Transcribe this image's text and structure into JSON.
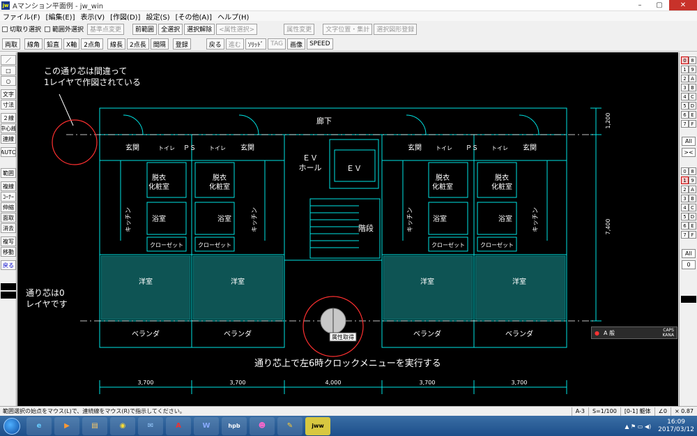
{
  "window": {
    "title": "Aマンション平面例 - jw_win",
    "app_icon": "jw"
  },
  "menu": [
    "ファイル(F)",
    "[編集(E)]",
    "表示(V)",
    "[作図(D)]",
    "設定(S)",
    "[その他(A)]",
    "ヘルプ(H)"
  ],
  "toolbar1": {
    "check1": "切取り選択",
    "check2": "範囲外選択",
    "btn_base": "基準点変更",
    "btn_prev": "前範囲",
    "btn_all": "全選択",
    "btn_clear": "選択解除",
    "btn_attr_sel": "<属性選択>",
    "btn_attr_change": "属性変更",
    "btn_text_pos": "文字位置・集計",
    "btn_sel_register": "選択図形登録"
  },
  "toolbar2": {
    "items": [
      "両取",
      "線角",
      "鉛直",
      "X軸",
      "2点角",
      "線長",
      "2点長",
      "間隔",
      "登録"
    ],
    "items_b": [
      "戻る",
      "進む",
      "ｿﾘｯﾄﾞ",
      "TAG",
      "画像",
      "SPEED"
    ]
  },
  "leftbar": [
    "／",
    "□",
    "○",
    "文字",
    "寸法",
    "２線",
    "中心線",
    "連線",
    "AUTO",
    "範囲",
    "複線",
    "ｺｰﾅｰ",
    "伸縮",
    "面取",
    "消去",
    "複写",
    "移動",
    "戻る"
  ],
  "rightbar": {
    "layers_left": [
      "0",
      "1",
      "2",
      "3",
      "4",
      "5",
      "6",
      "7"
    ],
    "layers_right": [
      "8",
      "9",
      "A",
      "B",
      "C",
      "D",
      "E",
      "F"
    ],
    "all": "All",
    "swap": "><",
    "groups_left": [
      "0",
      "1",
      "2",
      "3",
      "4",
      "5",
      "6",
      "7"
    ],
    "groups_right": [
      "8",
      "9",
      "A",
      "B",
      "C",
      "D",
      "E",
      "F"
    ],
    "all2": "All",
    "zero": "0"
  },
  "drawing": {
    "note1": [
      "この通り芯は間違って",
      "1レイヤで作図されている"
    ],
    "note2": [
      "通り芯は0",
      "レイヤです"
    ],
    "note3": "通り芯上で左6時クロックメニューを実行する",
    "attr_tag": "属性取得",
    "corridor": "廊下",
    "ev_hall": [
      "ＥＶ",
      "ホール"
    ],
    "ev": "ＥＶ",
    "stairs": "階段",
    "entrance": "玄関",
    "toilet": "トイレ",
    "ps": "ＰＳ",
    "dressing": [
      "脱衣",
      "化粧室"
    ],
    "bath": "浴室",
    "kitchen": "キッチン",
    "closet": "クローゼット",
    "western_room": "洋室",
    "veranda": "ベランダ",
    "dims_bottom": [
      "3,700",
      "3,700",
      "4,000",
      "3,700",
      "3,700"
    ],
    "dims_right": [
      "1,200",
      "7,400"
    ],
    "colors": {
      "line": "#00ffff",
      "text": "#ffffff",
      "annotation": "#ffffff",
      "circle": "#ff3030",
      "axis": "#ffffff"
    }
  },
  "ime_panel": {
    "label": "A 般",
    "caps": "CAPS",
    "kana": "KANA"
  },
  "status": {
    "message": "範囲選択の始点をマウス(L)で、連続線をマウス(R)で指示してください。",
    "paper": "A-3",
    "scale": "S=1/100",
    "layer": "[0-1] 躯体",
    "angle": "∠0",
    "zoom": "× 0.87"
  },
  "taskbar": {
    "apps": [
      "IE",
      "Media",
      "Explorer",
      "Chrome",
      "Mail",
      "A",
      "W",
      "hpb",
      "Game",
      "Paint",
      "jww"
    ],
    "time": "16:09",
    "date": "2017/03/12"
  }
}
